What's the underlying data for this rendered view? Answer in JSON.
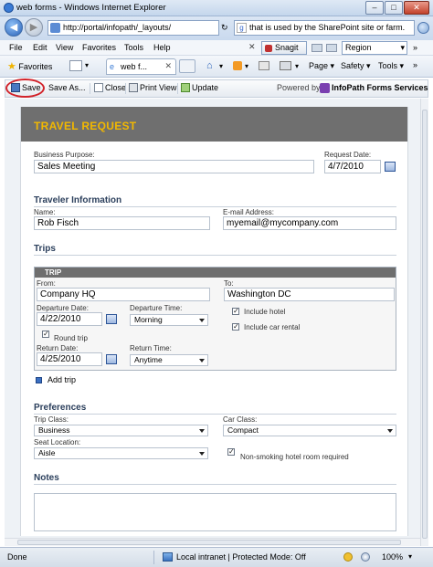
{
  "window": {
    "title": "web forms - Windows Internet Explorer"
  },
  "address": {
    "url": "http://portal/infopath/_layouts/",
    "search_text": "that is used by the SharePoint site or farm."
  },
  "menu": [
    "File",
    "Edit",
    "View",
    "Favorites",
    "Tools",
    "Help"
  ],
  "snagit_label": "Snagit",
  "region_label": "Region",
  "favorites_label": "Favorites",
  "tab_title": "web f...",
  "command_bar": {
    "page": "Page",
    "safety": "Safety",
    "tools": "Tools"
  },
  "ip_toolbar": {
    "save": "Save",
    "save_as": "Save As...",
    "close": "Close",
    "print_view": "Print View",
    "update": "Update",
    "powered_by": "Powered by:",
    "brand": "InfoPath Forms Services"
  },
  "form": {
    "title": "TRAVEL REQUEST",
    "business_purpose_label": "Business Purpose:",
    "business_purpose": "Sales Meeting",
    "request_date_label": "Request Date:",
    "request_date": "4/7/2010",
    "traveler_header": "Traveler Information",
    "name_label": "Name:",
    "name": "Rob Fisch",
    "email_label": "E-mail Address:",
    "email": "myemail@mycompany.com",
    "trips_header": "Trips",
    "trip": {
      "bar_title": "TRIP",
      "from_label": "From:",
      "from": "Company HQ",
      "to_label": "To:",
      "to": "Washington DC",
      "departure_date_label": "Departure Date:",
      "departure_date": "4/22/2010",
      "departure_time_label": "Departure Time:",
      "departure_time": "Morning",
      "include_hotel": "Include hotel",
      "include_car": "Include car rental",
      "round_trip": "Round trip",
      "return_date_label": "Return Date:",
      "return_date": "4/25/2010",
      "return_time_label": "Return Time:",
      "return_time": "Anytime"
    },
    "add_trip": "Add trip",
    "preferences_header": "Preferences",
    "trip_class_label": "Trip Class:",
    "trip_class": "Business",
    "car_class_label": "Car Class:",
    "car_class": "Compact",
    "seat_location_label": "Seat Location:",
    "seat_location": "Aisle",
    "non_smoking": "Non-smoking hotel room required",
    "notes_header": "Notes"
  },
  "status": {
    "left": "Done",
    "zone": "Local intranet | Protected Mode: Off",
    "zoom": "100%"
  },
  "colors": {
    "banner": "#6f6f6f",
    "title_yellow": "#f2b800",
    "save_highlight": "#d2232a"
  }
}
